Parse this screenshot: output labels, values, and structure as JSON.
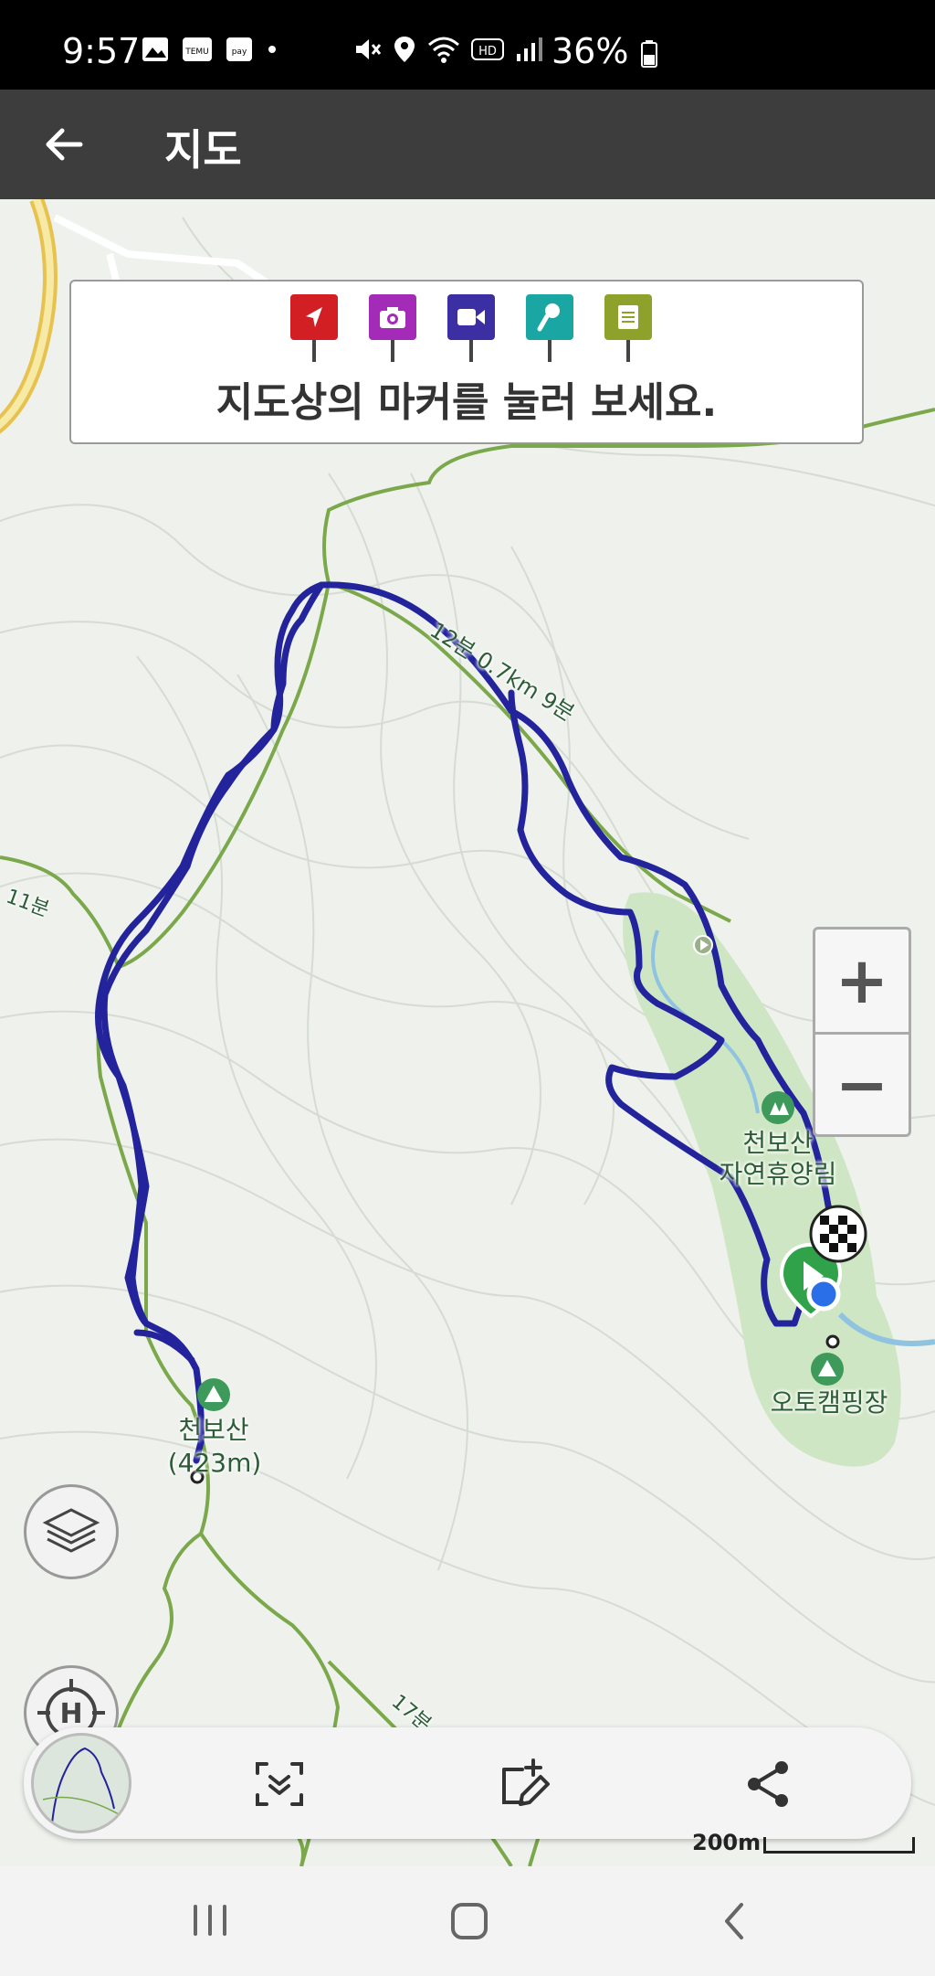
{
  "status_bar": {
    "time": "9:57",
    "battery": "36%"
  },
  "app_bar": {
    "title": "지도"
  },
  "marker_panel": {
    "hint": "지도상의 마커를 눌러 보세요.",
    "markers": [
      {
        "name": "waypoint-marker-icon",
        "color": "#d11f24"
      },
      {
        "name": "photo-marker-icon",
        "color": "#a32bb8"
      },
      {
        "name": "video-marker-icon",
        "color": "#3b2fa3"
      },
      {
        "name": "voice-marker-icon",
        "color": "#1aa7a4"
      },
      {
        "name": "memo-marker-icon",
        "color": "#8ea12a"
      }
    ]
  },
  "map": {
    "labels": {
      "peak_name": "천보산",
      "peak_height": "(423m)",
      "forest_line1": "천보산",
      "forest_line2": "자연휴양림",
      "camping": "오토캠핑장",
      "trail_label": "12분 0.7km 9분",
      "trail_label_left": "11분",
      "trail_label_bottom": "17분"
    },
    "colors": {
      "track": "#23239c",
      "trail": "#7aa84a",
      "background": "#eef1ec"
    }
  },
  "controls": {
    "zoom_in": "+",
    "zoom_out": "−",
    "scale": "200m"
  },
  "toolbar": {
    "icons": [
      "minimap",
      "scan-icon",
      "edit-track-icon",
      "share-icon"
    ]
  }
}
